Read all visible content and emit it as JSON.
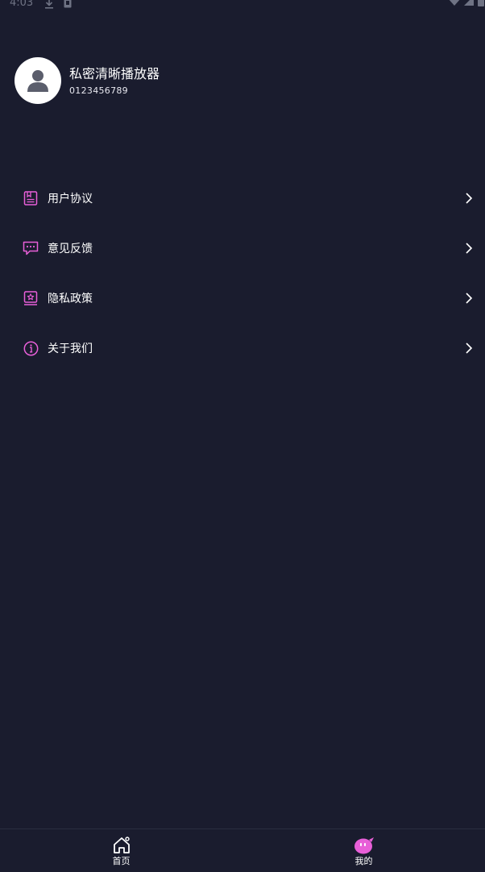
{
  "status_bar": {
    "time": "4:03",
    "icons": [
      "download-icon",
      "sim-icon",
      "wifi-icon",
      "signal-icon",
      "battery-icon"
    ]
  },
  "profile": {
    "name": "私密清晰播放器",
    "id": "0123456789"
  },
  "menu": {
    "items": [
      {
        "label": "用户协议",
        "icon": "book-icon"
      },
      {
        "label": "意见反馈",
        "icon": "feedback-icon"
      },
      {
        "label": "隐私政策",
        "icon": "privacy-icon"
      },
      {
        "label": "关于我们",
        "icon": "info-icon"
      }
    ]
  },
  "bottom_nav": {
    "items": [
      {
        "label": "首页",
        "icon": "home-icon"
      },
      {
        "label": "我的",
        "icon": "profile-face-icon",
        "active": true
      }
    ]
  },
  "colors": {
    "background": "#1a1c2e",
    "accent": "#e85fd8"
  }
}
